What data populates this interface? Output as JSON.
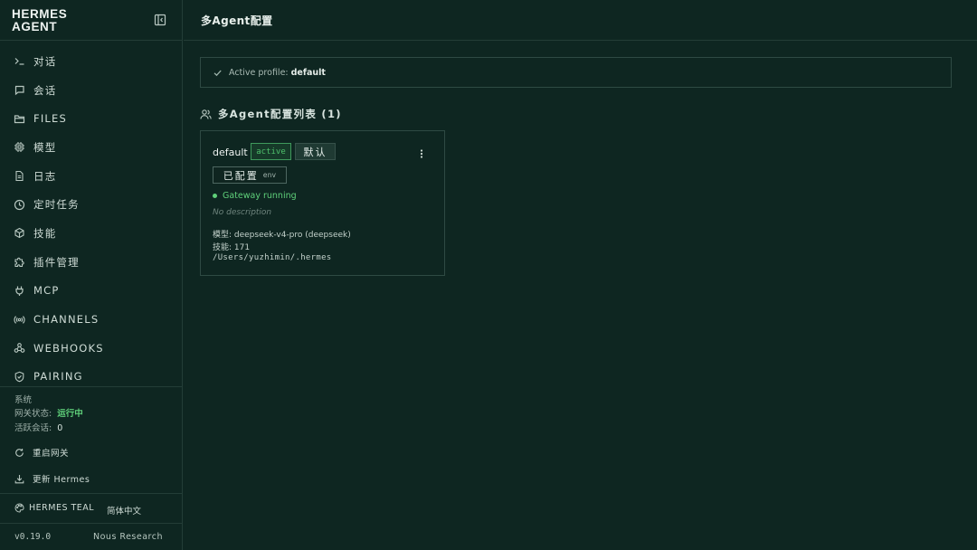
{
  "sidebar": {
    "brand_line1": "HERMES",
    "brand_line2": "AGENT",
    "collapse_icon": "sidebar-collapse-icon",
    "items": [
      {
        "label": "对话",
        "icon": "terminal-icon"
      },
      {
        "label": "会话",
        "icon": "message-icon"
      },
      {
        "label": "FILES",
        "icon": "folder-icon"
      },
      {
        "label": "模型",
        "icon": "chip-icon"
      },
      {
        "label": "日志",
        "icon": "file-text-icon"
      },
      {
        "label": "定时任务",
        "icon": "clock-icon"
      },
      {
        "label": "技能",
        "icon": "package-icon"
      },
      {
        "label": "插件管理",
        "icon": "puzzle-icon"
      },
      {
        "label": "MCP",
        "icon": "plug-icon"
      },
      {
        "label": "CHANNELS",
        "icon": "broadcast-icon"
      },
      {
        "label": "WEBHOOKS",
        "icon": "webhook-icon"
      },
      {
        "label": "PAIRING",
        "icon": "shield-icon"
      }
    ],
    "system": {
      "title": "系统",
      "gateway_label": "网关状态:",
      "gateway_value": "运行中",
      "sessions_label": "活跃会话:",
      "sessions_value": "0",
      "restart_label": "重启网关",
      "update_label": "更新 Hermes"
    },
    "theme_label": "HERMES TEAL",
    "language_label": "简体中文",
    "version": "v0.19.0",
    "org": "Nous Research"
  },
  "header": {
    "title": "多Agent配置"
  },
  "banner": {
    "label": "Active profile:",
    "value": "default"
  },
  "profiles": {
    "heading": "多Agent配置列表 (1)",
    "items": [
      {
        "name": "default",
        "active_badge": "active",
        "default_badge": "默认",
        "config_badge": "已配置",
        "config_env": "env",
        "status": "Gateway running",
        "description": "No description",
        "model_line": "模型: deepseek-v4-pro (deepseek)",
        "skills_line": "技能: 171",
        "path": "/Users/yuzhimin/.hermes"
      }
    ]
  },
  "colors": {
    "background": "#0e2621",
    "border": "#233d37",
    "accent_green": "#5fd07a"
  }
}
